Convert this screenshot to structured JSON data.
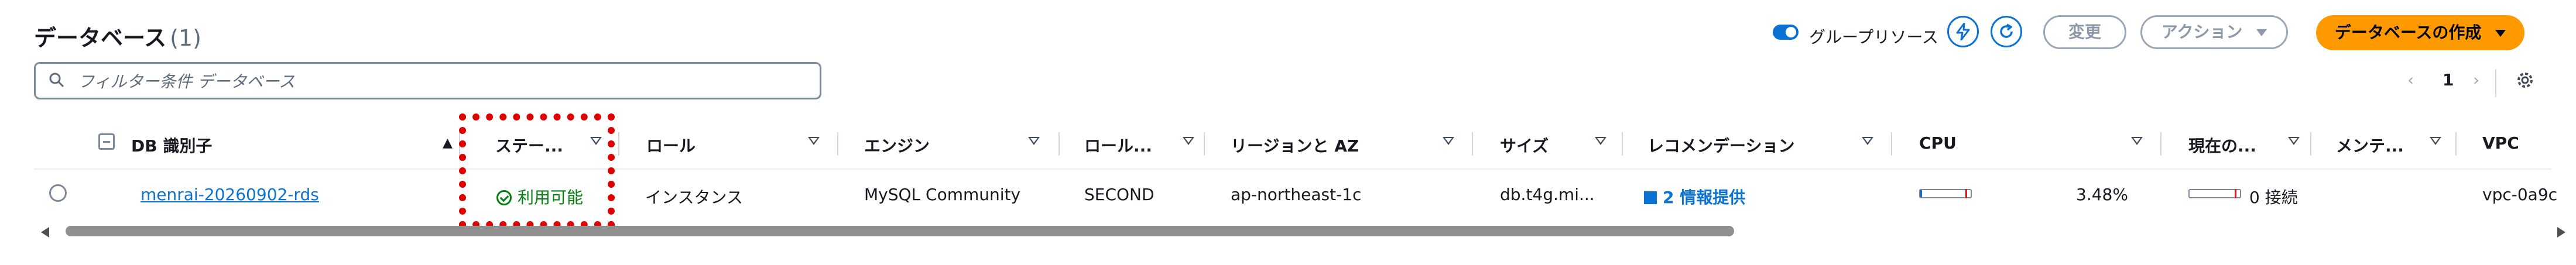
{
  "header": {
    "title": "データベース",
    "count": "(1)",
    "group_toggle_label": "グループリソース",
    "modify_label": "変更",
    "actions_label": "アクション",
    "create_label": "データベースの作成"
  },
  "search": {
    "placeholder": "フィルター条件 データベース"
  },
  "pagination": {
    "prev": "‹",
    "page": "1",
    "next": "›"
  },
  "table": {
    "columns": [
      "DB 識別子",
      "ステー...",
      "ロール",
      "エンジン",
      "ロール...",
      "リージョンと AZ",
      "サイズ",
      "レコメンデーション",
      "CPU",
      "現在の...",
      "メンテ...",
      "VPC"
    ],
    "sort_indicator": "▲",
    "rows": [
      {
        "db_id": "menrai-20260902-rds",
        "status": "利用可能",
        "role": "インスタンス",
        "engine": "MySQL Community",
        "role_type": "SECOND",
        "region_az": "ap-northeast-1c",
        "size": "db.t4g.mi...",
        "recommendation": "2 情報提供",
        "cpu": "3.48%",
        "cpu_fraction": 0.0348,
        "connections": "0 接続",
        "vpc": "vpc-0a9c"
      }
    ]
  },
  "colors": {
    "accent": "#0972d3",
    "primary_button": "#ff9900",
    "available": "#037f0c",
    "annotation": "#e00000"
  },
  "icons": [
    "refresh-lightning-icon",
    "refresh-icon",
    "search-icon",
    "settings-icon",
    "caret-down-icon",
    "filter-icon"
  ]
}
